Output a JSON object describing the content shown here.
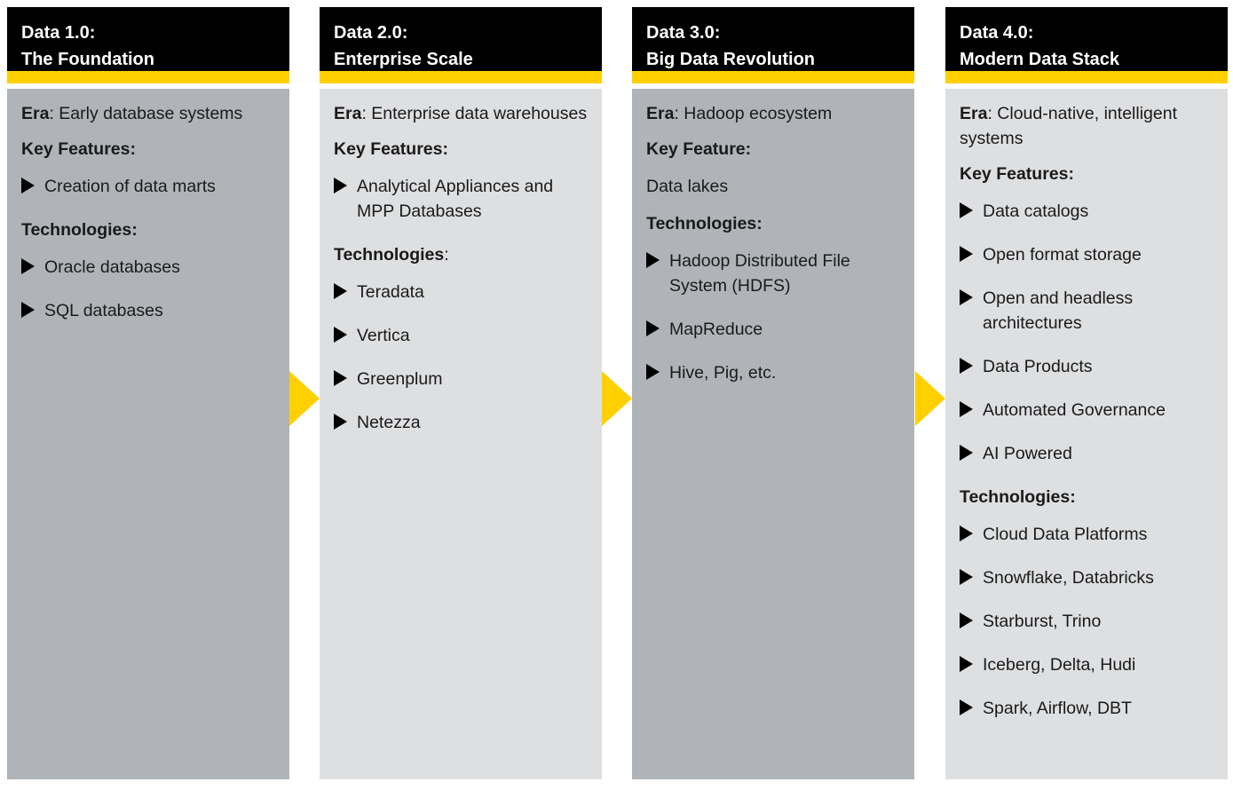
{
  "colors": {
    "header_bg": "#000000",
    "accent": "#ffd000",
    "panel_dark": "#b0b4b8",
    "panel_light": "#dedfe1"
  },
  "icons": {
    "bullet": "triangle-bullet-icon",
    "connector": "yellow-chevron-arrow-icon"
  },
  "columns": [
    {
      "title_line1": "Data 1.0:",
      "title_line2": "The Foundation",
      "era_label": "Era",
      "era_value": ": Early database systems",
      "features_heading": "Key Features:",
      "features": [
        "Creation of data marts"
      ],
      "tech_heading": "Technologies:",
      "tech": [
        "Oracle databases",
        "SQL databases"
      ]
    },
    {
      "title_line1": "Data 2.0:",
      "title_line2": "Enterprise Scale",
      "era_label": "Era",
      "era_value": ": Enterprise data warehouses",
      "features_heading": "Key Features:",
      "features": [
        "Analytical Appliances and MPP Databases"
      ],
      "tech_heading": "Technologies",
      "tech_heading_suffix": ":",
      "tech": [
        "Teradata",
        "Vertica",
        "Greenplum",
        "Netezza"
      ]
    },
    {
      "title_line1": "Data 3.0:",
      "title_line2": "Big Data Revolution",
      "era_label": "Era",
      "era_value": ": Hadoop ecosystem",
      "features_heading": "Key Feature:",
      "feature_text": "Data lakes",
      "tech_heading": "Technologies:",
      "tech": [
        "Hadoop Distributed File System (HDFS)",
        "MapReduce",
        "Hive, Pig, etc."
      ]
    },
    {
      "title_line1": "Data 4.0:",
      "title_line2": "Modern Data Stack",
      "era_label": "Era",
      "era_value": ": Cloud-native, intelligent systems",
      "features_heading": "Key Features:",
      "features": [
        "Data catalogs",
        "Open format storage",
        "Open and headless architectures",
        "Data Products",
        "Automated Governance",
        "AI Powered"
      ],
      "tech_heading": "Technologies:",
      "tech": [
        "Cloud Data Platforms",
        "Snowflake, Databricks",
        "Starburst, Trino",
        "Iceberg, Delta, Hudi",
        "Spark, Airflow, DBT"
      ]
    }
  ]
}
